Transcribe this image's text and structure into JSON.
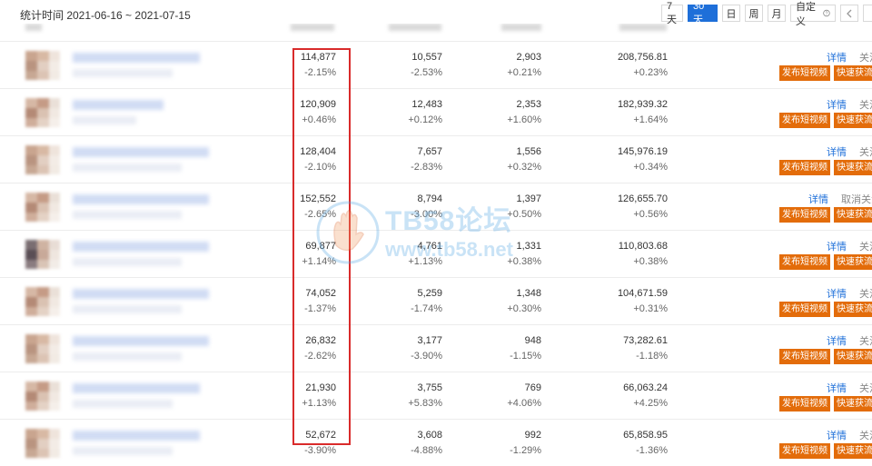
{
  "toolbar": {
    "stat_time": "统计时间 2021-06-16 ~ 2021-07-15",
    "ranges": [
      "7天",
      "30天",
      "日",
      "周",
      "月",
      "自定义"
    ],
    "active_range": "30天",
    "custom_icon": "help-circle-icon",
    "prev_icon": "chevron-left-icon"
  },
  "actions": {
    "detail": "详情",
    "follow": "关注",
    "unfollow": "取消关注",
    "publish": "发布短视频",
    "boost": "快速获流量"
  },
  "rows": [
    {
      "c1": "114,877",
      "c1c": "-2.15%",
      "c2": "10,557",
      "c2c": "-2.53%",
      "c3": "2,903",
      "c3c": "+0.21%",
      "c4": "208,756.81",
      "c4c": "+0.23%",
      "follow": "关注"
    },
    {
      "c1": "120,909",
      "c1c": "+0.46%",
      "c2": "12,483",
      "c2c": "+0.12%",
      "c3": "2,353",
      "c3c": "+1.60%",
      "c4": "182,939.32",
      "c4c": "+1.64%",
      "follow": "关注"
    },
    {
      "c1": "128,404",
      "c1c": "-2.10%",
      "c2": "7,657",
      "c2c": "-2.83%",
      "c3": "1,556",
      "c3c": "+0.32%",
      "c4": "145,976.19",
      "c4c": "+0.34%",
      "follow": "关注"
    },
    {
      "c1": "152,552",
      "c1c": "-2.65%",
      "c2": "8,794",
      "c2c": "-3.00%",
      "c3": "1,397",
      "c3c": "+0.50%",
      "c4": "126,655.70",
      "c4c": "+0.56%",
      "follow": "取消关注"
    },
    {
      "c1": "69,877",
      "c1c": "+1.14%",
      "c2": "4,761",
      "c2c": "+1.13%",
      "c3": "1,331",
      "c3c": "+0.38%",
      "c4": "110,803.68",
      "c4c": "+0.38%",
      "follow": "关注"
    },
    {
      "c1": "74,052",
      "c1c": "-1.37%",
      "c2": "5,259",
      "c2c": "-1.74%",
      "c3": "1,348",
      "c3c": "+0.30%",
      "c4": "104,671.59",
      "c4c": "+0.31%",
      "follow": "关注"
    },
    {
      "c1": "26,832",
      "c1c": "-2.62%",
      "c2": "3,177",
      "c2c": "-3.90%",
      "c3": "948",
      "c3c": "-1.15%",
      "c4": "73,282.61",
      "c4c": "-1.18%",
      "follow": "关注"
    },
    {
      "c1": "21,930",
      "c1c": "+1.13%",
      "c2": "3,755",
      "c2c": "+5.83%",
      "c3": "769",
      "c3c": "+4.06%",
      "c4": "66,063.24",
      "c4c": "+4.25%",
      "follow": "关注"
    },
    {
      "c1": "52,672",
      "c1c": "-3.90%",
      "c2": "3,608",
      "c2c": "-4.88%",
      "c3": "992",
      "c3c": "-1.29%",
      "c4": "65,858.95",
      "c4c": "-1.36%",
      "follow": "关注"
    }
  ],
  "watermark": {
    "title": "TB58论坛",
    "url": "www.tb58.net"
  },
  "colors": {
    "accent": "#1e6fd9",
    "action_orange": "#e36c0a",
    "highlight_red": "#d92b2b"
  }
}
